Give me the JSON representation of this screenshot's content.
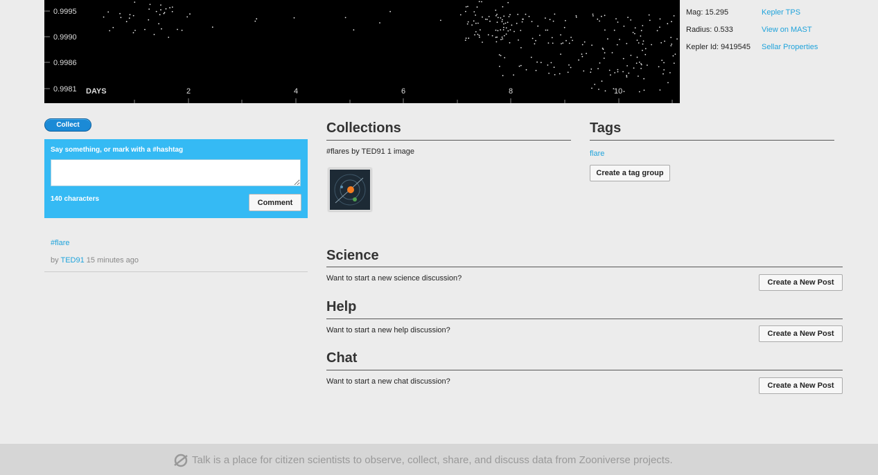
{
  "lightcurve": {
    "y_ticks": [
      "0.9995",
      "0.9990",
      "0.9986",
      "0.9981"
    ],
    "x_axis_label": "DAYS",
    "x_ticks": [
      "2",
      "4",
      "6",
      "8",
      "10"
    ]
  },
  "star_info": {
    "mag": "Mag: 15.295",
    "radius": "Radius: 0.533",
    "kepler_id": "Kepler Id: 9419545",
    "links": [
      "Kepler TPS",
      "View on MAST",
      "Sellar Properties"
    ]
  },
  "collect_label": "Collect",
  "comment": {
    "prompt": "Say something, or mark with a #hashtag",
    "text_value": "",
    "char_count": "140 characters",
    "button_label": "Comment"
  },
  "entry": {
    "hashtag": "#flare",
    "by": "by",
    "user": "TED91",
    "time": "15 minutes ago"
  },
  "collections": {
    "title": "Collections",
    "item_text": "#flares by TED91 1 image"
  },
  "tags": {
    "title": "Tags",
    "tag": "flare",
    "create_button": "Create a tag group"
  },
  "boards": [
    {
      "title": "Science",
      "text": "Want to start a new science discussion?",
      "button": "Create a New Post"
    },
    {
      "title": "Help",
      "text": "Want to start a new help discussion?",
      "button": "Create a New Post"
    },
    {
      "title": "Chat",
      "text": "Want to start a new chat discussion?",
      "button": "Create a New Post"
    }
  ],
  "footer": {
    "text": "Talk is a place for citizen scientists to observe, collect, share, and discuss data from Zooniverse projects.",
    "icon": "zooniverse-icon"
  },
  "colors": {
    "accent": "#35baf4",
    "link": "#1fa3db",
    "collect_button": "#1b8ad6",
    "plot_bg": "#000000"
  }
}
